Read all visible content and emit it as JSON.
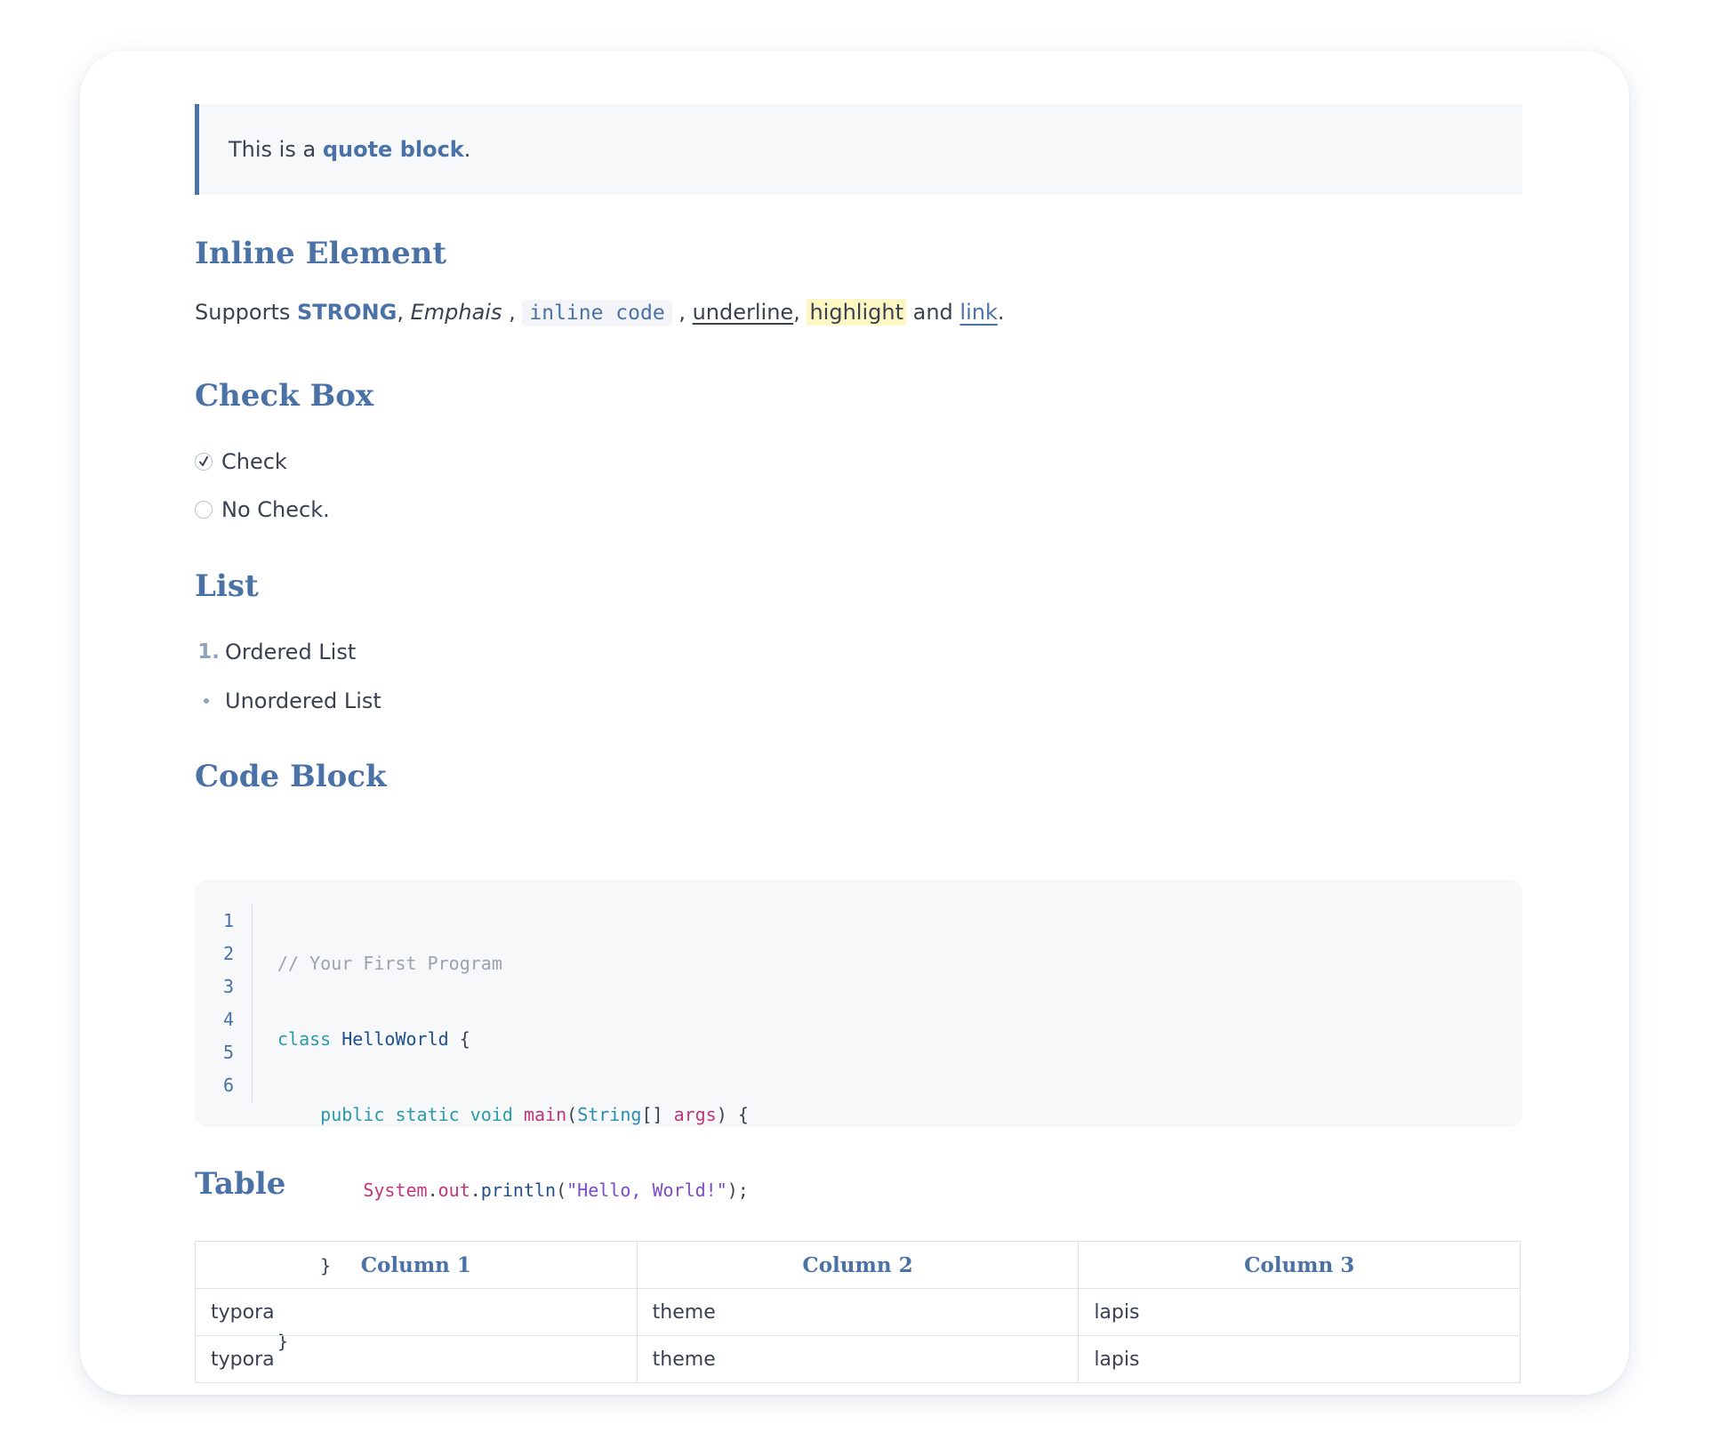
{
  "quote": {
    "prefix": "This is a ",
    "strong": "quote block",
    "suffix": "."
  },
  "inline": {
    "heading": "Inline Element",
    "supports": "Supports ",
    "strong": "STRONG",
    "sep1": ", ",
    "emphasis": "Emphais",
    "sep2": " , ",
    "code": "inline code",
    "sep3": " , ",
    "underline": "underline",
    "sep4": ", ",
    "highlight": "highlight",
    "and": " and ",
    "link": "link",
    "end": "."
  },
  "checkbox": {
    "heading": "Check Box",
    "items": [
      {
        "label": "Check",
        "checked": true
      },
      {
        "label": "No Check.",
        "checked": false
      }
    ]
  },
  "list": {
    "heading": "List",
    "ordered_number": "1.",
    "ordered_item": "Ordered List",
    "unordered_item": "Unordered List"
  },
  "code_block": {
    "heading": "Code Block",
    "line_numbers": [
      "1",
      "2",
      "3",
      "4",
      "5",
      "6"
    ],
    "lines": {
      "l1_comment": "// Your First Program",
      "l2_kw": "class",
      "l2_cls": "HelloWorld",
      "l2_punc": " {",
      "l3_indent": "    ",
      "l3_kw": "public static void",
      "l3_fn": "main",
      "l3_p1": "(",
      "l3_type": "String",
      "l3_p2": "[] ",
      "l3_args": "args",
      "l3_p3": ") {",
      "l4_indent": "        ",
      "l4_obj": "System",
      "l4_dot1": ".",
      "l4_out": "out",
      "l4_dot2": ".",
      "l4_fn": "println",
      "l4_p1": "(",
      "l4_str": "\"Hello, World!\"",
      "l4_p2": ");",
      "l5": "    }",
      "l6": "}"
    }
  },
  "table": {
    "heading": "Table",
    "headers": [
      "Column 1",
      "Column 2",
      "Column 3"
    ],
    "rows": [
      [
        "typora",
        "theme",
        "lapis"
      ],
      [
        "typora",
        "theme",
        "lapis"
      ]
    ]
  },
  "colors": {
    "accent": "#4a72a6",
    "highlight": "#fdf7c3",
    "code_background": "#f6f8fa"
  }
}
